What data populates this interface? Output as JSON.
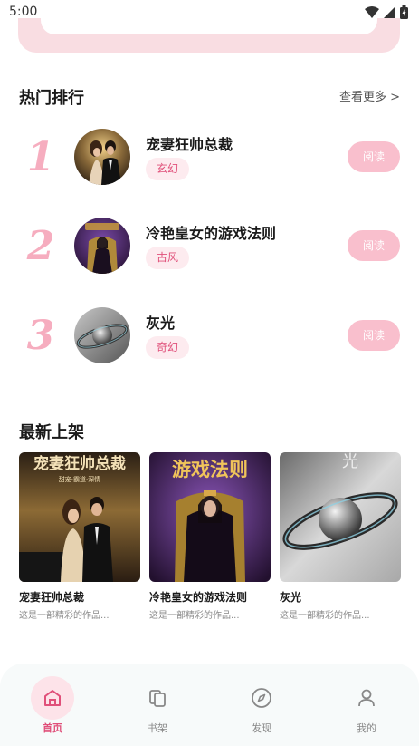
{
  "status": {
    "time": "5:00"
  },
  "hot": {
    "title": "热门排行",
    "see_more": "查看更多 >",
    "items": [
      {
        "rank": "1",
        "title": "宠妻狂帅总裁",
        "tag": "玄幻",
        "action": "阅读"
      },
      {
        "rank": "2",
        "title": "冷艳皇女的游戏法则",
        "tag": "古风",
        "action": "阅读"
      },
      {
        "rank": "3",
        "title": "灰光",
        "tag": "奇幻",
        "action": "阅读"
      }
    ]
  },
  "latest": {
    "title": "最新上架",
    "items": [
      {
        "title": "宠妻狂帅总裁",
        "desc": "这是一部精彩的作品...",
        "cover_text": "宠妻狂帅总裁",
        "cover_sub": "—甜宠·霸道·深情—"
      },
      {
        "title": "冷艳皇女的游戏法则",
        "desc": "这是一部精彩的作品...",
        "cover_text": "游戏法则"
      },
      {
        "title": "灰光",
        "desc": "这是一部精彩的作品...",
        "cover_text": "光"
      }
    ]
  },
  "nav": {
    "items": [
      {
        "label": "首页",
        "icon": "home-icon",
        "active": true
      },
      {
        "label": "书架",
        "icon": "bookshelf-icon",
        "active": false
      },
      {
        "label": "发现",
        "icon": "compass-icon",
        "active": false
      },
      {
        "label": "我的",
        "icon": "user-icon",
        "active": false
      }
    ]
  },
  "colors": {
    "accent": "#e0507a",
    "rank": "#f6adbf",
    "read_button": "#f9bfcd",
    "tag_bg": "#fdebef"
  }
}
